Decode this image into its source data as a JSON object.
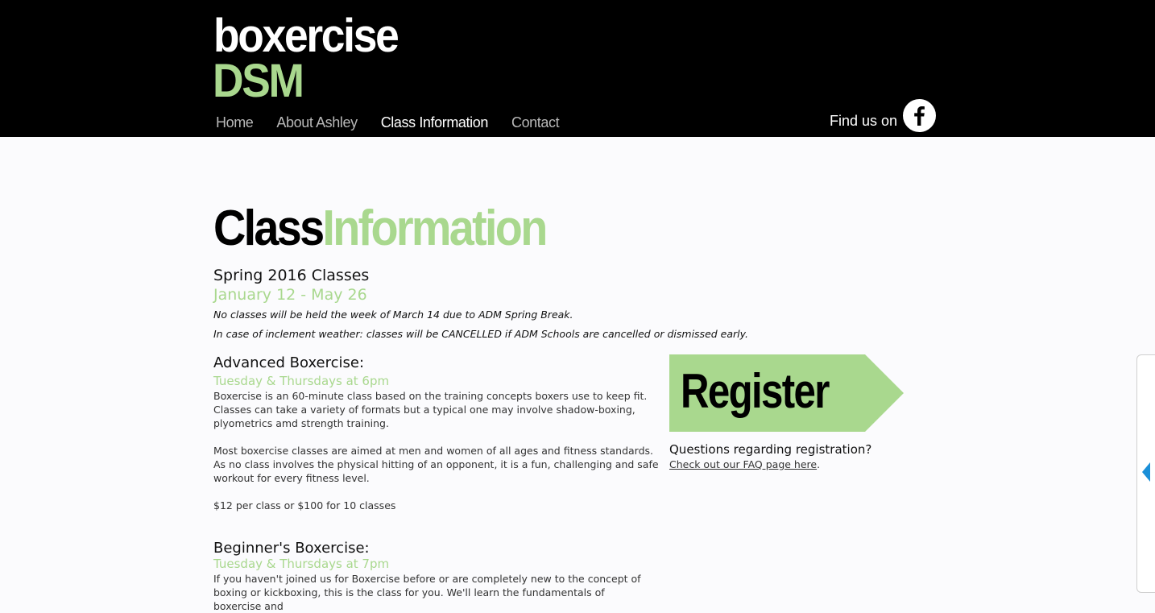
{
  "header": {
    "logo_line1": "boxercise",
    "logo_line2": "DSM",
    "nav": [
      "Home",
      "About Ashley",
      "Class Information",
      "Contact"
    ],
    "active_nav": "Class Information",
    "find_us": "Find us on",
    "social_icon": "facebook-icon"
  },
  "colors": {
    "accent_green": "#a9d88e",
    "header_bg": "#000000",
    "nav_inactive": "#b8b8b8"
  },
  "main": {
    "title_part1": "Class",
    "title_part2": "Information",
    "season": "Spring 2016 Classes",
    "dates": "January 12 - May 26",
    "note1": "No classes will be held the week of March 14 due to ADM Spring Break.",
    "note2": "In case of inclement weather: classes will be CANCELLED if ADM Schools are cancelled or dismissed early.",
    "advanced": {
      "title": "Advanced Boxercise:",
      "time": "Tuesday & Thursdays at 6pm",
      "para1": "Boxercise is an 60-minute class based on the training concepts boxers use to keep fit. Classes can take a variety of formats but a typical one may involve shadow-boxing, plyometrics amd strength training.",
      "para2": "Most boxercise classes are aimed at men and women of all ages and fitness standards. As no class involves the physical hitting of an opponent, it is a fun, challenging and safe workout for every fitness level.",
      "price": "$12 per class or $100 for 10 classes"
    },
    "beginner": {
      "title": "Beginner's Boxercise:",
      "time": "Tuesday & Thursdays at 7pm",
      "para1": "If you haven't joined us for Boxercise before or are completely new to the concept of boxing or kickboxing, this is the class for you. We'll learn the fundamentals of boxercise and"
    }
  },
  "sidebar": {
    "register_label": "Register",
    "question": "Questions regarding registration?",
    "faq_link": "Check out our FAQ page here",
    "faq_suffix": "."
  }
}
